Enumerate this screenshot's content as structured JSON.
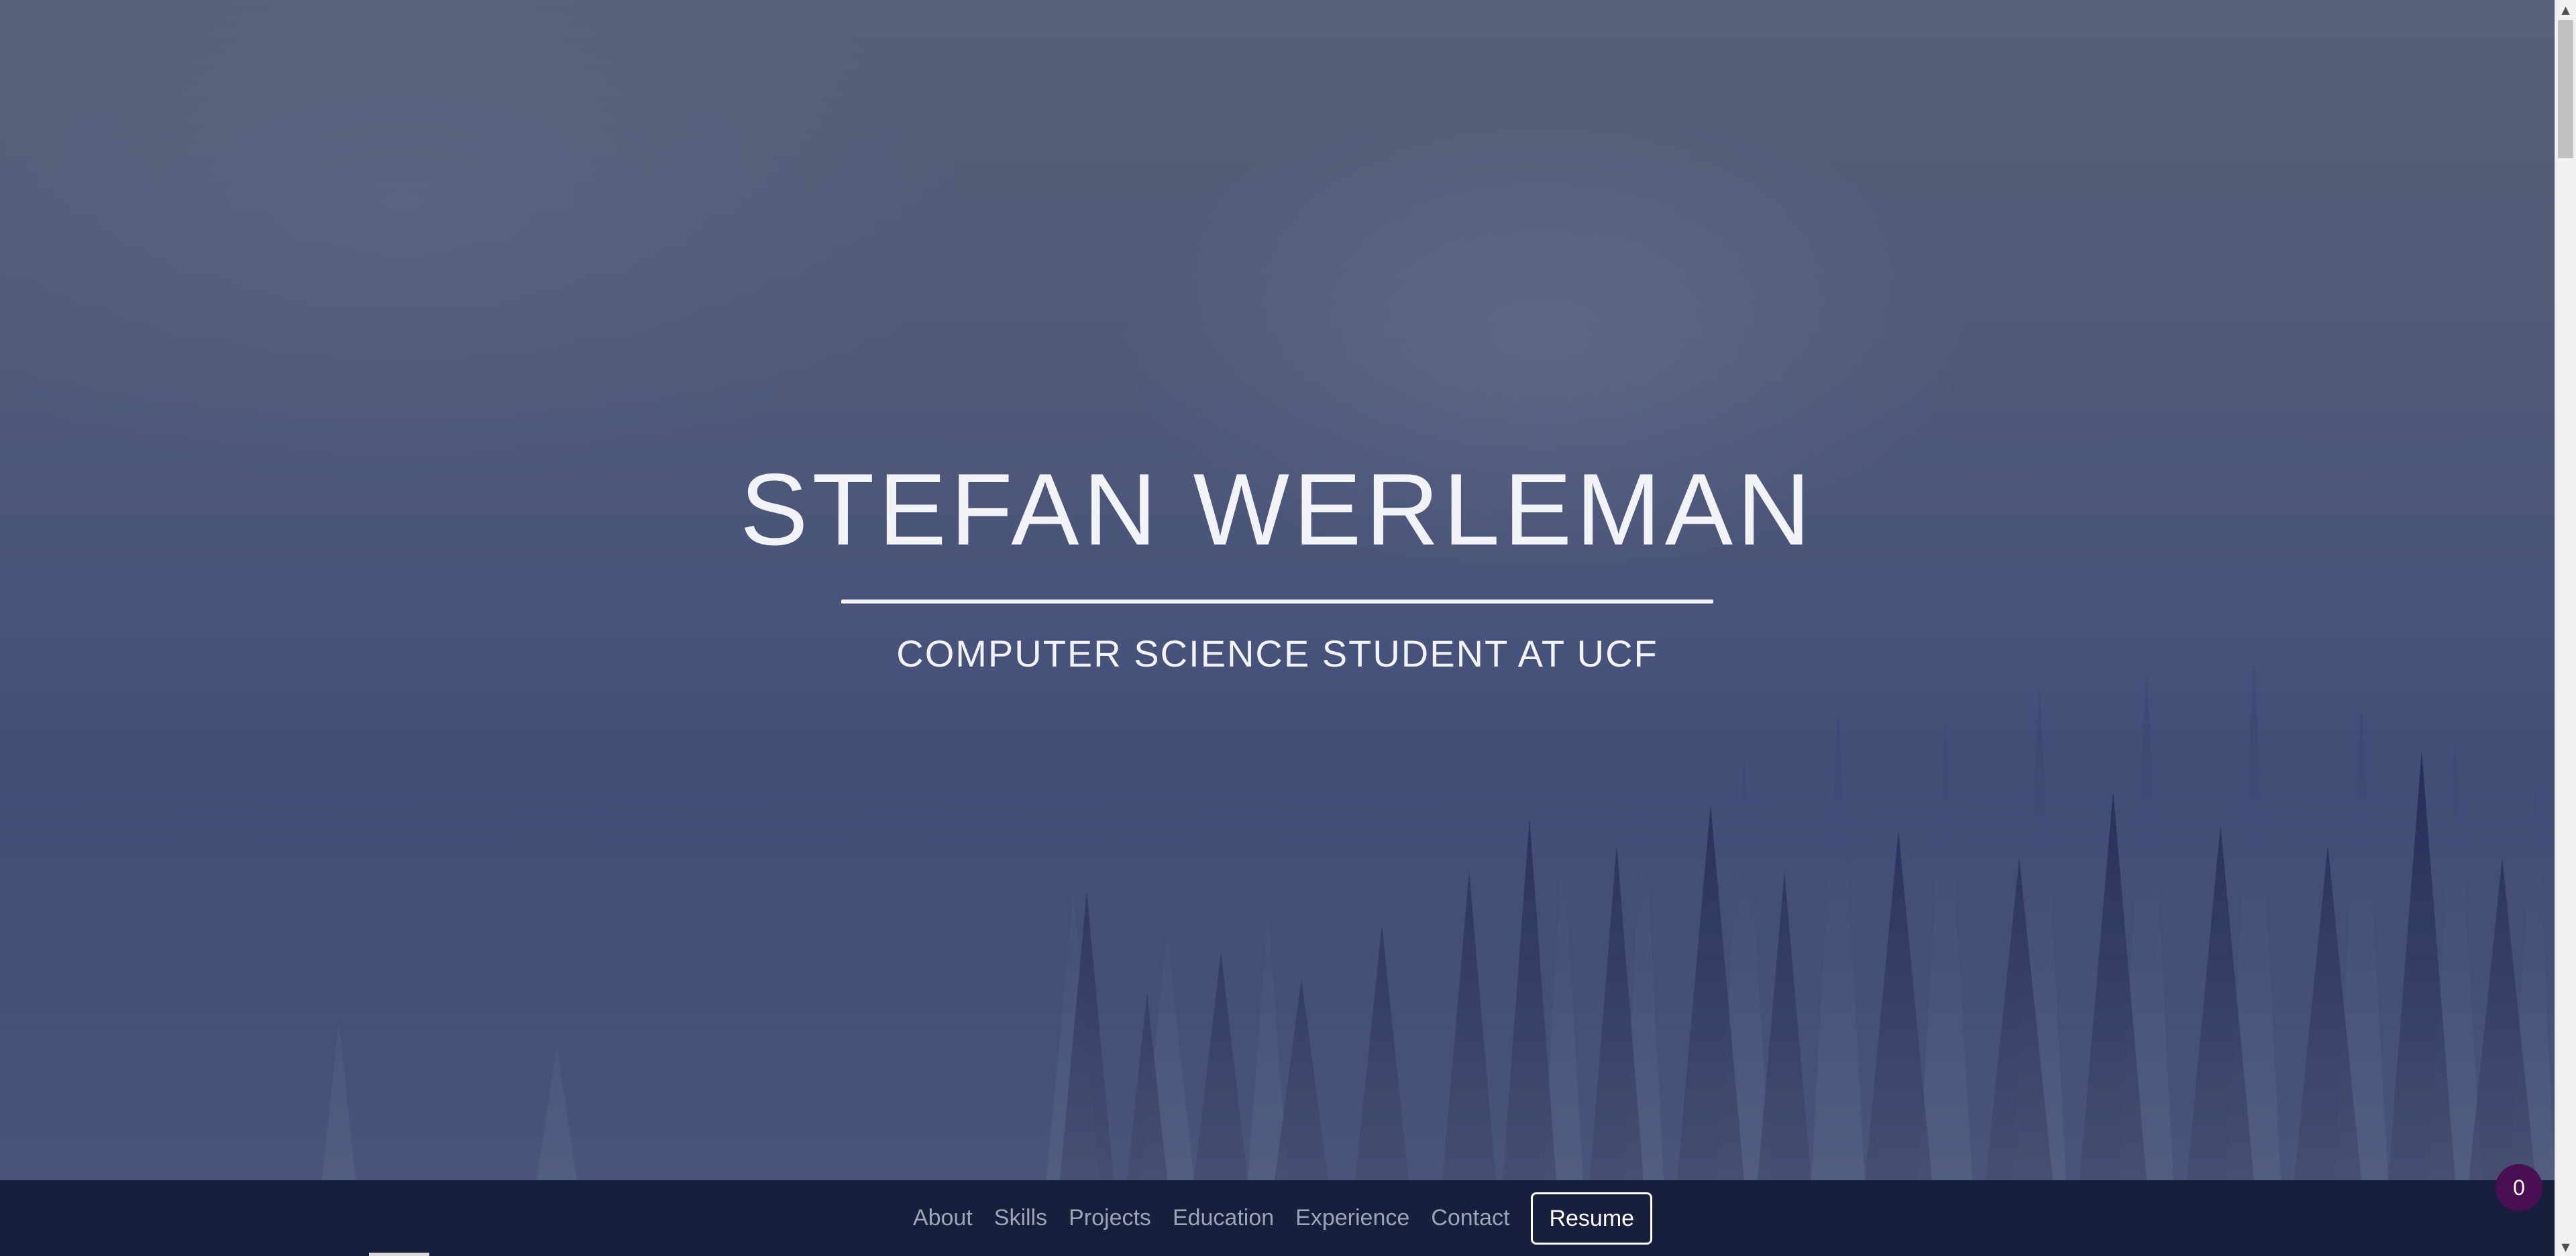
{
  "hero": {
    "title": "STEFAN WERLEMAN",
    "subtitle": "COMPUTER SCIENCE STUDENT AT UCF"
  },
  "nav": {
    "items": [
      {
        "label": "About"
      },
      {
        "label": "Skills"
      },
      {
        "label": "Projects"
      },
      {
        "label": "Education"
      },
      {
        "label": "Experience"
      },
      {
        "label": "Contact"
      }
    ],
    "resume_label": "Resume"
  },
  "badge": {
    "count": "0"
  },
  "scrollbar": {
    "up_arrow": "▲",
    "down_arrow": "▼"
  },
  "colors": {
    "navbar": "#181f3c",
    "badge": "#4a0e52",
    "hero_text": "#f2f3f7",
    "nav_text": "#9ea4b8"
  }
}
